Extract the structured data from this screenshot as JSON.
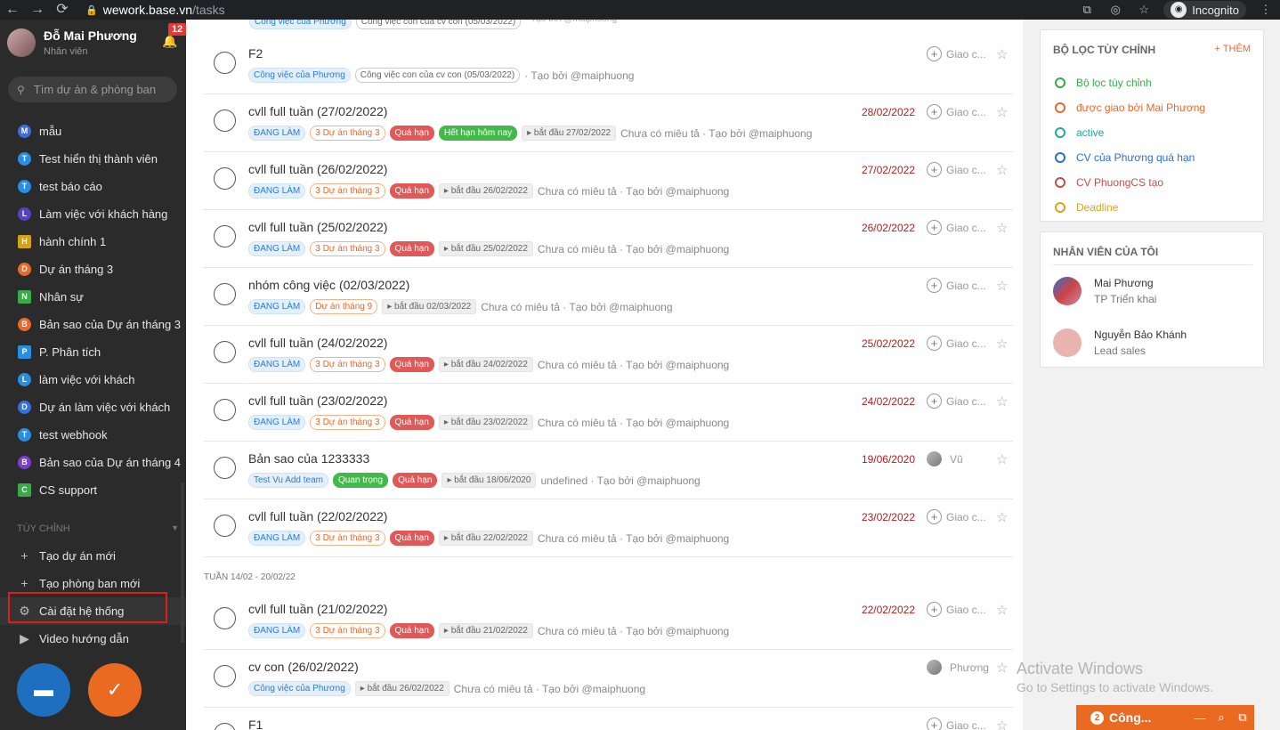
{
  "browser": {
    "host": "wework.base.vn",
    "path": "/tasks",
    "incognito_label": "Incognito",
    "back_icon": "←",
    "forward_icon": "→",
    "reload_icon": "⟳",
    "lock_icon": "🔒",
    "translate_icon": "⧉",
    "eye_icon": "◎",
    "star_icon": "☆",
    "menu_icon": "⋮"
  },
  "sidebar": {
    "user_name": "Đỗ Mai Phương",
    "user_role": "Nhân viên",
    "notification_count": "12",
    "search_placeholder": "Tìm dự án & phòng ban",
    "projects": [
      {
        "letter": "M",
        "label": "mẫu",
        "color": "#3b6fd8",
        "round": true
      },
      {
        "letter": "T",
        "label": "Test hiển thị thành viên",
        "color": "#2a8ee0",
        "round": true
      },
      {
        "letter": "T",
        "label": "test báo cáo",
        "color": "#2a8ee0",
        "round": true
      },
      {
        "letter": "L",
        "label": "Làm việc với khách hàng",
        "color": "#5a3fc8",
        "round": true
      },
      {
        "letter": "H",
        "label": "hành chính 1",
        "color": "#d4a21a",
        "round": false
      },
      {
        "letter": "D",
        "label": "Dự án tháng 3",
        "color": "#e8692e",
        "round": true
      },
      {
        "letter": "N",
        "label": "Nhân sự",
        "color": "#3aa94a",
        "round": false
      },
      {
        "letter": "B",
        "label": "Bản sao của Dự án tháng 3",
        "color": "#e8692e",
        "round": true
      },
      {
        "letter": "P",
        "label": "P. Phân tích",
        "color": "#2a8ee0",
        "round": false
      },
      {
        "letter": "L",
        "label": "làm việc với khách",
        "color": "#2a8ee0",
        "round": true
      },
      {
        "letter": "D",
        "label": "Dự án làm việc với khách",
        "color": "#3b6fd8",
        "round": true
      },
      {
        "letter": "T",
        "label": "test webhook",
        "color": "#2a8ee0",
        "round": true
      },
      {
        "letter": "B",
        "label": "Bản sao của Dự án tháng 4",
        "color": "#7b3fc8",
        "round": true
      },
      {
        "letter": "C",
        "label": "CS support",
        "color": "#3aa94a",
        "round": false
      }
    ],
    "section_title": "TÙY CHỈNH",
    "custom_items": [
      {
        "icon": "+",
        "icon_name": "plus-square-icon",
        "label": "Tạo dự án mới"
      },
      {
        "icon": "+",
        "icon_name": "plus-square-icon",
        "label": "Tạo phòng ban mới"
      },
      {
        "icon": "⚙",
        "icon_name": "gear-icon",
        "label": "Cài đặt hệ thống"
      },
      {
        "icon": "▶",
        "icon_name": "video-icon",
        "label": "Video hướng dẫn"
      }
    ],
    "fab_chat_icon": "▬",
    "fab_task_icon": "✓",
    "fab_chat_color": "#1e6fbf",
    "fab_task_color": "#ea6a22"
  },
  "tasks_top": [
    {
      "title": "F2",
      "tags": [
        {
          "text": "Công việc của Phương",
          "style": "blue"
        },
        {
          "text": "Công việc con của cv con (05/03/2022)",
          "style": "gray"
        }
      ],
      "desc": "· Tạo bởi @maiphuong",
      "date": "",
      "assignee": "Giao c...",
      "avatar": false
    },
    {
      "title": "cvll full tuần (27/02/2022)",
      "tags": [
        {
          "text": "ĐANG LÀM",
          "style": "blue"
        },
        {
          "text": "3 Dự án tháng 3",
          "style": "orange"
        },
        {
          "text": "Quá hạn",
          "style": "red"
        },
        {
          "text": "Hết hạn hôm nay",
          "style": "green"
        },
        {
          "text": "▸ bắt đầu 27/02/2022",
          "style": "start"
        }
      ],
      "desc": "Chưa có miêu tả · Tạo bởi @maiphuong",
      "date": "28/02/2022",
      "assignee": "Giao c...",
      "avatar": false
    },
    {
      "title": "cvll full tuần (26/02/2022)",
      "tags": [
        {
          "text": "ĐANG LÀM",
          "style": "blue"
        },
        {
          "text": "3 Dự án tháng 3",
          "style": "orange"
        },
        {
          "text": "Quá hạn",
          "style": "red"
        },
        {
          "text": "▸ bắt đầu 26/02/2022",
          "style": "start"
        }
      ],
      "desc": "Chưa có miêu tả · Tạo bởi @maiphuong",
      "date": "27/02/2022",
      "assignee": "Giao c...",
      "avatar": false
    },
    {
      "title": "cvll full tuần (25/02/2022)",
      "tags": [
        {
          "text": "ĐANG LÀM",
          "style": "blue"
        },
        {
          "text": "3 Dự án tháng 3",
          "style": "orange"
        },
        {
          "text": "Quá hạn",
          "style": "red"
        },
        {
          "text": "▸ bắt đầu 25/02/2022",
          "style": "start"
        }
      ],
      "desc": "Chưa có miêu tả · Tạo bởi @maiphuong",
      "date": "26/02/2022",
      "assignee": "Giao c...",
      "avatar": false
    },
    {
      "title": "nhóm công việc (02/03/2022)",
      "tags": [
        {
          "text": "ĐANG LÀM",
          "style": "blue"
        },
        {
          "text": "Dự án tháng 9",
          "style": "orange"
        },
        {
          "text": "▸ bắt đầu 02/03/2022",
          "style": "start"
        }
      ],
      "desc": "Chưa có miêu tả · Tạo bởi @maiphuong",
      "date": "",
      "assignee": "Giao c...",
      "avatar": false
    },
    {
      "title": "cvll full tuần (24/02/2022)",
      "tags": [
        {
          "text": "ĐANG LÀM",
          "style": "blue"
        },
        {
          "text": "3 Dự án tháng 3",
          "style": "orange"
        },
        {
          "text": "Quá hạn",
          "style": "red"
        },
        {
          "text": "▸ bắt đầu 24/02/2022",
          "style": "start"
        }
      ],
      "desc": "Chưa có miêu tả · Tạo bởi @maiphuong",
      "date": "25/02/2022",
      "assignee": "Giao c...",
      "avatar": false
    },
    {
      "title": "cvll full tuần (23/02/2022)",
      "tags": [
        {
          "text": "ĐANG LÀM",
          "style": "blue"
        },
        {
          "text": "3 Dự án tháng 3",
          "style": "orange"
        },
        {
          "text": "Quá hạn",
          "style": "red"
        },
        {
          "text": "▸ bắt đầu 23/02/2022",
          "style": "start"
        }
      ],
      "desc": "Chưa có miêu tả · Tạo bởi @maiphuong",
      "date": "24/02/2022",
      "assignee": "Giao c...",
      "avatar": false
    },
    {
      "title": "Bản sao của 1233333",
      "tags": [
        {
          "text": "Test Vu Add team",
          "style": "blue"
        },
        {
          "text": "Quan trọng",
          "style": "green"
        },
        {
          "text": "Quá hạn",
          "style": "red"
        },
        {
          "text": "▸ bắt đầu 18/06/2020",
          "style": "start"
        }
      ],
      "desc": "undefined · Tạo bởi @maiphuong",
      "date": "19/06/2020",
      "assignee": "Vũ",
      "avatar": true
    },
    {
      "title": "cvll full tuần (22/02/2022)",
      "tags": [
        {
          "text": "ĐANG LÀM",
          "style": "blue"
        },
        {
          "text": "3 Dự án tháng 3",
          "style": "orange"
        },
        {
          "text": "Quá hạn",
          "style": "red"
        },
        {
          "text": "▸ bắt đầu 22/02/2022",
          "style": "start"
        }
      ],
      "desc": "Chưa có miêu tả · Tạo bởi @maiphuong",
      "date": "23/02/2022",
      "assignee": "Giao c...",
      "avatar": false
    }
  ],
  "week_label": "TUẦN 14/02 - 20/02/22",
  "tasks_week": [
    {
      "title": "cvll full tuần (21/02/2022)",
      "tags": [
        {
          "text": "ĐANG LÀM",
          "style": "blue"
        },
        {
          "text": "3 Dự án tháng 3",
          "style": "orange"
        },
        {
          "text": "Quá hạn",
          "style": "red"
        },
        {
          "text": "▸ bắt đầu 21/02/2022",
          "style": "start"
        }
      ],
      "desc": "Chưa có miêu tả · Tạo bởi @maiphuong",
      "date": "22/02/2022",
      "assignee": "Giao c...",
      "avatar": false
    },
    {
      "title": "cv con (26/02/2022)",
      "tags": [
        {
          "text": "Công việc của Phương",
          "style": "blue"
        },
        {
          "text": "▸ bắt đầu 26/02/2022",
          "style": "start"
        }
      ],
      "desc": "Chưa có miêu tả · Tạo bởi @maiphuong",
      "date": "",
      "assignee": "Phương",
      "avatar": true
    },
    {
      "title": "F1",
      "tags": [],
      "desc": "",
      "date": "",
      "assignee": "Giao c...",
      "avatar": false
    }
  ],
  "filters": {
    "title": "BỘ LỌC TÙY CHỈNH",
    "add_label": "+ THÊM",
    "items": [
      {
        "label": "Bộ lọc tùy chỉnh",
        "color": "#3aa94a"
      },
      {
        "label": "được giao bởi Mai Phương",
        "color": "#e8692e"
      },
      {
        "label": "active",
        "color": "#26a69a"
      },
      {
        "label": "CV của Phương quá hạn",
        "color": "#2a6fd8"
      },
      {
        "label": "CV PhuongCS tạo",
        "color": "#c0504d"
      },
      {
        "label": "Deadline",
        "color": "#e0a020"
      }
    ]
  },
  "employees": {
    "title": "NHÂN VIÊN CỦA TÔI",
    "items": [
      {
        "name": "Mai Phương",
        "role": "TP Triển khai"
      },
      {
        "name": "Nguyễn Bảo Khánh",
        "role": "Lead sales"
      }
    ]
  },
  "watermark": {
    "line1": "Activate Windows",
    "line2": "Go to Settings to activate Windows."
  },
  "chatbar": {
    "count": "2",
    "title": "Công...",
    "minimize_icon": "—",
    "search_icon": "⌕",
    "popout_icon": "⧉"
  }
}
